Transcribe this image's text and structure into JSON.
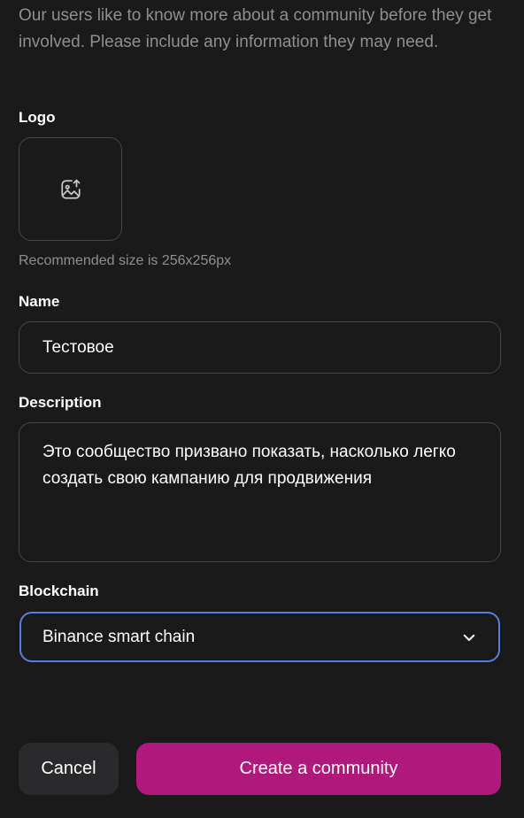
{
  "intro": {
    "text": "Our users like to know more about a community before they get involved. Please include any information they may need."
  },
  "logo": {
    "label": "Logo",
    "hint": "Recommended size is 256x256px",
    "icon": "image-upload-icon"
  },
  "name": {
    "label": "Name",
    "value": "Тестовое"
  },
  "description": {
    "label": "Description",
    "value": "Это сообщество призвано показать, насколько легко создать свою кампанию для продвижения"
  },
  "blockchain": {
    "label": "Blockchain",
    "selected": "Binance smart chain",
    "icon": "chevron-down-icon",
    "focus_color": "#5b7be0"
  },
  "actions": {
    "cancel_label": "Cancel",
    "create_label": "Create a community",
    "create_color": "#b1187c"
  }
}
